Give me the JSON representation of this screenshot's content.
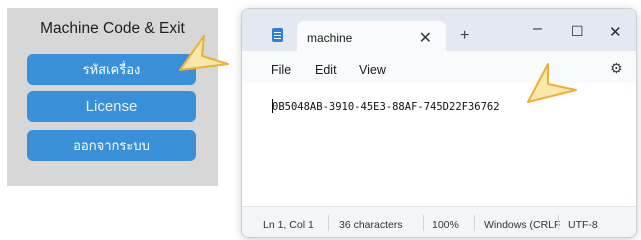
{
  "left_panel": {
    "title": "Machine Code & Exit",
    "buttons": [
      {
        "label": "รหัสเครื่อง"
      },
      {
        "label": "License"
      },
      {
        "label": "ออกจากระบบ"
      }
    ]
  },
  "notepad": {
    "tab_title": "machine",
    "tab_close": "✕",
    "new_tab": "+",
    "window_controls": {
      "minimize": "–",
      "maximize": "☐",
      "close": "✕"
    },
    "menu": {
      "file": "File",
      "edit": "Edit",
      "view": "View"
    },
    "settings_icon": "⚙",
    "content": "0B5048AB-3910-45E3-88AF-745D22F36762",
    "status": {
      "position": "Ln 1, Col 1",
      "characters": "36 characters",
      "zoom": "100%",
      "line_ending": "Windows (CRLF",
      "encoding": "UTF-8"
    }
  },
  "colors": {
    "button_blue": "#3a8fd9",
    "panel_gray": "#d7d7d7",
    "arrow_yellow": "#f5c84a"
  }
}
